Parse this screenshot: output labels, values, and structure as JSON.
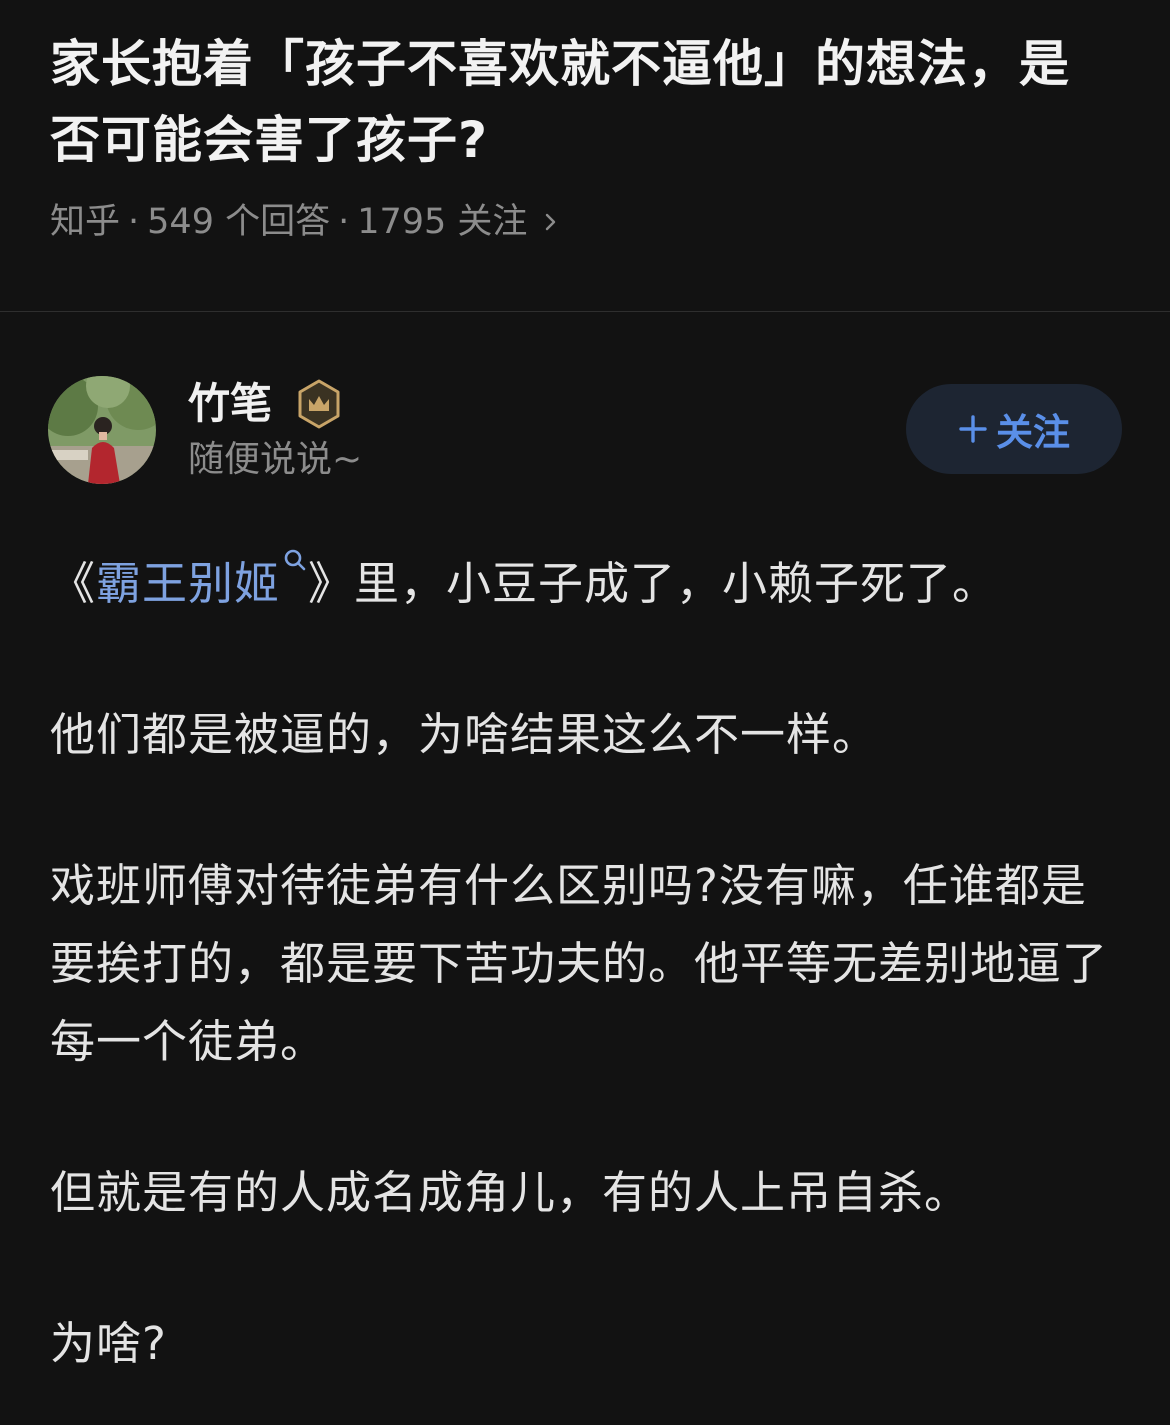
{
  "question": {
    "title": "家长抱着「孩子不喜欢就不逼他」的想法，是否可能会害了孩子?",
    "source": "知乎",
    "answer_count": "549 个回答",
    "follow_count": "1795 关注",
    "separator": "·"
  },
  "author": {
    "name": "竹笔",
    "bio": "随便说说~",
    "follow_label": "关注",
    "badge_icon": "crown-badge-icon"
  },
  "answer": {
    "p1_prefix": "《",
    "p1_link": "霸王别姬",
    "p1_suffix": "》里，小豆子成了，小赖子死了。",
    "p2": "他们都是被逼的，为啥结果这么不一样。",
    "p3": "戏班师傅对待徒弟有什么区别吗?没有嘛，任谁都是要挨打的，都是要下苦功夫的。他平等无差别地逼了每一个徒弟。",
    "p4": "但就是有的人成名成角儿，有的人上吊自杀。",
    "p5": "为啥?"
  },
  "colors": {
    "background": "#121212",
    "link": "#7ea2e0",
    "follow_text": "#5a8fe8",
    "follow_bg": "#1d2532",
    "badge": "#c8a468",
    "meta": "#8c8c8c"
  }
}
